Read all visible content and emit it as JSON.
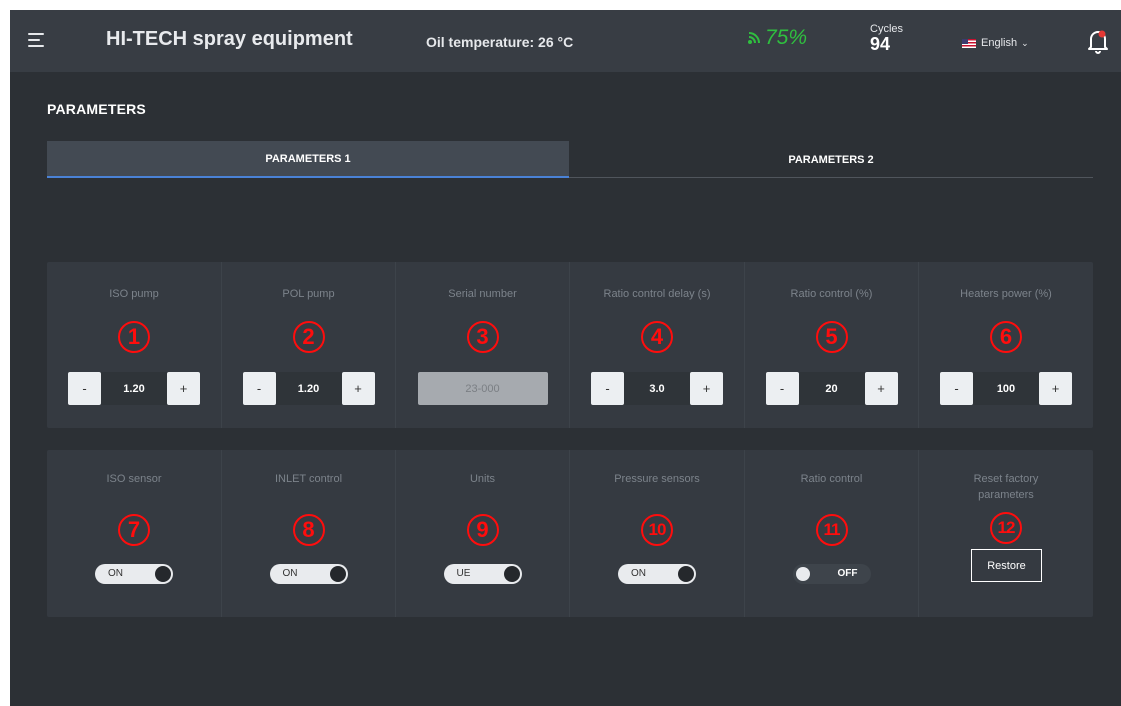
{
  "header": {
    "title": "HI-TECH spray equipment",
    "oil_temperature": "Oil temperature: 26 °C",
    "signal": "75%",
    "cycles_label": "Cycles",
    "cycles_value": "94",
    "language": "English",
    "accent_color": "#2fbf3f"
  },
  "page": {
    "title": "PARAMETERS"
  },
  "tabs": [
    {
      "label": "PARAMETERS 1",
      "active": true
    },
    {
      "label": "PARAMETERS 2",
      "active": false
    }
  ],
  "parameters": [
    {
      "label": "ISO pump",
      "marker": "1",
      "value": "1.20",
      "minus": "-",
      "plus": "+"
    },
    {
      "label": "POL pump",
      "marker": "2",
      "value": "1.20",
      "minus": "-",
      "plus": "+"
    },
    {
      "label": "Serial number",
      "marker": "3",
      "value": "23-000"
    },
    {
      "label": "Ratio control delay (s)",
      "marker": "4",
      "value": "3.0",
      "minus": "-",
      "plus": "+"
    },
    {
      "label": "Ratio control (%)",
      "marker": "5",
      "value": "20",
      "minus": "-",
      "plus": "+"
    },
    {
      "label": "Heaters power (%)",
      "marker": "6",
      "value": "100",
      "minus": "-",
      "plus": "+"
    }
  ],
  "settings": [
    {
      "label": "ISO sensor",
      "marker": "7",
      "state": "ON"
    },
    {
      "label": "INLET control",
      "marker": "8",
      "state": "ON"
    },
    {
      "label": "Units",
      "marker": "9",
      "state": "UE"
    },
    {
      "label": "Pressure sensors",
      "marker": "10",
      "state": "ON"
    },
    {
      "label": "Ratio control",
      "marker": "11",
      "state": "OFF"
    },
    {
      "label": "Reset factory parameters",
      "marker": "12",
      "button": "Restore"
    }
  ],
  "marker_color": "#ff0d0d"
}
